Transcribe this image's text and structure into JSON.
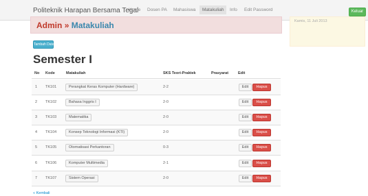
{
  "navbar": {
    "brand": "Politeknik Harapan Bersama Tegal",
    "items": [
      {
        "label": "Home"
      },
      {
        "label": "Dosen PA"
      },
      {
        "label": "Mahasiswa"
      },
      {
        "label": "Matakuliah",
        "active": true
      },
      {
        "label": "Info"
      },
      {
        "label": "Edit Password"
      }
    ],
    "logout_label": "Keluar"
  },
  "header": {
    "section": "Admin",
    "separator": "»",
    "page": "Matakuliah"
  },
  "date_note": "Kamis, 11 Juli 2013",
  "add_button_label": "Tambah Data",
  "semester_title": "Semester I",
  "table": {
    "columns": [
      "No",
      "Kode",
      "Matakuliah",
      "SKS Teori-Praktek",
      "Prasyarat",
      "Edit"
    ],
    "rows": [
      {
        "no": "1",
        "kode": "TK101",
        "matakuliah": "Perangkat Keras Komputer (Hardware)",
        "sks": "2-2",
        "prasyarat": ""
      },
      {
        "no": "2",
        "kode": "TK102",
        "matakuliah": "Bahasa Inggris I",
        "sks": "2-0",
        "prasyarat": ""
      },
      {
        "no": "3",
        "kode": "TK103",
        "matakuliah": "Matematika",
        "sks": "2-0",
        "prasyarat": ""
      },
      {
        "no": "4",
        "kode": "TK104",
        "matakuliah": "Konsep Teknologi Informasi (KTI)",
        "sks": "2-0",
        "prasyarat": ""
      },
      {
        "no": "5",
        "kode": "TK105",
        "matakuliah": "Otomatisasi Perkantoran",
        "sks": "0-3",
        "prasyarat": ""
      },
      {
        "no": "6",
        "kode": "TK106",
        "matakuliah": "Komputer Multimedia",
        "sks": "2-1",
        "prasyarat": ""
      },
      {
        "no": "7",
        "kode": "TK107",
        "matakuliah": "Sistem Operasi",
        "sks": "2-0",
        "prasyarat": ""
      }
    ],
    "edit_label": "Edit",
    "delete_label": "Hapus"
  },
  "back_link": "« Kembali",
  "colors": {
    "danger": "#da4f49",
    "info": "#49afcd",
    "success": "#5cb85c",
    "title_red": "#c0392b",
    "title_blue": "#3a87ad"
  }
}
